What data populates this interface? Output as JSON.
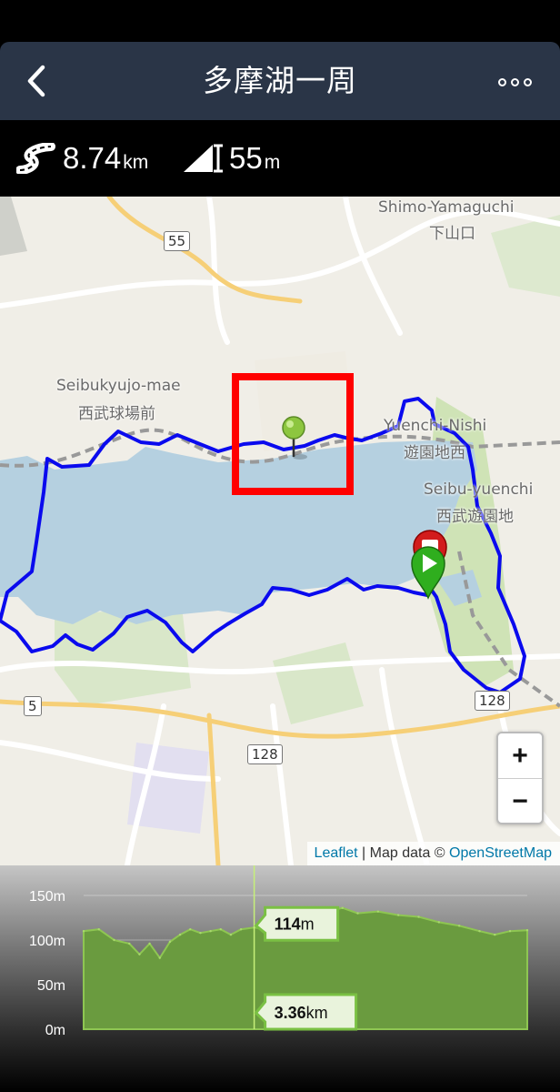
{
  "header": {
    "title": "多摩湖一周",
    "back_icon": "chevron-left-icon",
    "more_icon": "more-icon"
  },
  "stats": {
    "distance_icon": "road-icon",
    "distance": "8.74",
    "distance_unit": "km",
    "elevation_icon": "elevation-icon",
    "elevation": "55",
    "elevation_unit": "m"
  },
  "map": {
    "labels": {
      "shimo_yamaguchi_en": "Shimo-Yamaguchi",
      "shimo_yamaguchi_ja": "下山口",
      "seibukyujo_en": "Seibukyujo-mae",
      "seibukyujo_ja": "西武球場前",
      "yuenchi_nishi_en": "Yuenchi-Nishi",
      "yuenchi_nishi_ja": "遊園地西",
      "seibu_yuenchi_en": "Seibu-yuenchi",
      "seibu_yuenchi_ja": "西武遊園地"
    },
    "roads": [
      "55",
      "5",
      "128",
      "128"
    ],
    "zoom_in": "+",
    "zoom_out": "−",
    "attribution_link": "Leaflet",
    "attribution_text": "| Map data ©",
    "attribution_link2": "OpenStreetMap",
    "route_color": "#0a0aee",
    "water_color": "#b5d0e0",
    "markers": [
      "current-position-pin",
      "start-pin",
      "end-pin"
    ]
  },
  "elevation_chart": {
    "y_ticks": [
      "150m",
      "100m",
      "50m",
      "0m"
    ],
    "cursor_elevation": "114",
    "cursor_elevation_unit": "m",
    "cursor_distance": "3.36",
    "cursor_distance_unit": "km",
    "fill_color": "#6a9b3f"
  },
  "chart_data": {
    "type": "area",
    "xlabel": "",
    "ylabel": "",
    "ylim": [
      0,
      150
    ],
    "xlim": [
      0,
      8.74
    ],
    "cursor": {
      "x": 3.36,
      "y": 114
    },
    "x": [
      0,
      0.3,
      0.6,
      0.9,
      1.1,
      1.3,
      1.5,
      1.7,
      1.9,
      2.1,
      2.3,
      2.5,
      2.7,
      2.9,
      3.1,
      3.36,
      3.6,
      3.9,
      4.2,
      4.5,
      4.8,
      5.1,
      5.4,
      5.8,
      6.2,
      6.6,
      7.0,
      7.4,
      7.8,
      8.1,
      8.4,
      8.74
    ],
    "series": [
      {
        "values": [
          110,
          112,
          100,
          96,
          84,
          96,
          80,
          98,
          106,
          112,
          108,
          110,
          112,
          106,
          112,
          114,
          112,
          124,
          108,
          126,
          132,
          136,
          130,
          132,
          128,
          126,
          120,
          116,
          110,
          106,
          110,
          111
        ]
      }
    ]
  }
}
